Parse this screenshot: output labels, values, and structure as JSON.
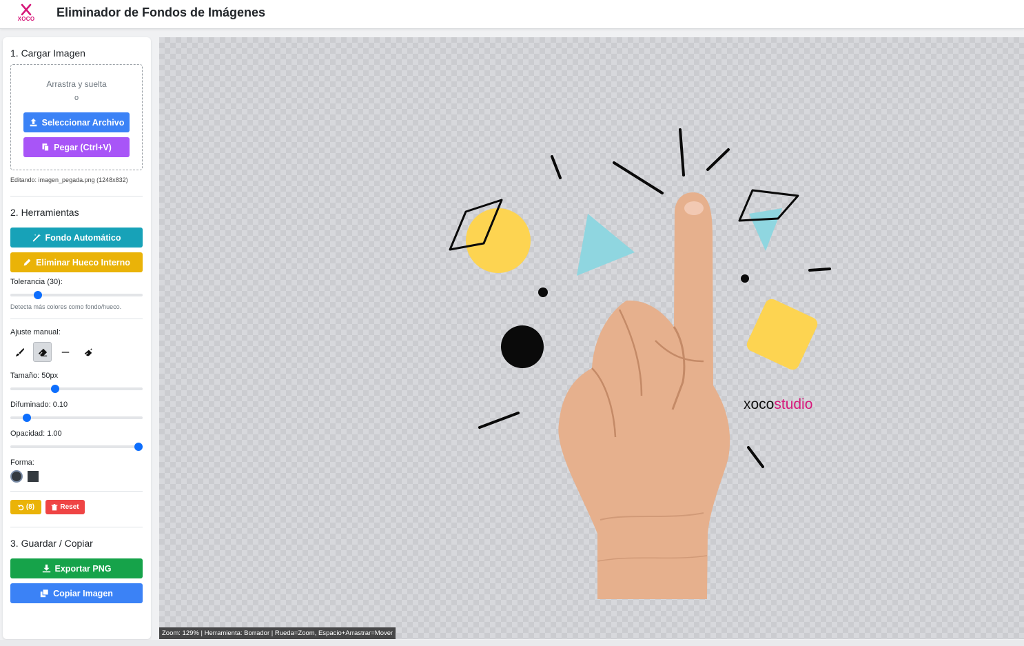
{
  "header": {
    "logo_text": "XOCO",
    "title": "Eliminador de Fondos de Imágenes"
  },
  "sidebar": {
    "section1": {
      "title": "1. Cargar Imagen",
      "drop_text": "Arrastra y suelta",
      "or_text": "o",
      "select_button": "Seleccionar Archivo",
      "paste_button": "Pegar (Ctrl+V)",
      "editing_note": "Editando: imagen_pegada.png (1248x832)"
    },
    "section2": {
      "title": "2. Herramientas",
      "auto_bg_button": "Fondo Automático",
      "remove_hole_button": "Eliminar Hueco Interno",
      "tolerance_label": "Tolerancia (30):",
      "tolerance_value": 30,
      "tolerance_note": "Detecta más colores como fondo/hueco.",
      "manual_label": "Ajuste manual:",
      "tools": [
        "brush-icon",
        "eraser-icon",
        "line-icon",
        "magic-eraser-icon"
      ],
      "active_tool": "eraser-icon",
      "size_label": "Tamaño: 50px",
      "size_value": 50,
      "feather_label": "Difuminado: 0.10",
      "feather_value": 0.1,
      "opacity_label": "Opacidad: 1.00",
      "opacity_value": 1.0,
      "shape_label": "Forma:",
      "shapes": [
        "circle",
        "square"
      ],
      "selected_shape": "circle",
      "undo_button": "(8)",
      "reset_button": "Reset"
    },
    "section3": {
      "title": "3. Guardar / Copiar",
      "export_button": "Exportar PNG",
      "copy_button": "Copiar Imagen"
    }
  },
  "canvas": {
    "watermark_left": "xoco",
    "watermark_right": "studio",
    "status": "Zoom: 129% | Herramienta: Borrador | Rueda=Zoom, Espacio+Arrastrar=Mover"
  },
  "colors": {
    "primary_blue": "#3b82f6",
    "purple": "#a855f7",
    "teal": "#17a2b8",
    "yellow": "#eab308",
    "red": "#ef4444",
    "green": "#16a34a",
    "brand_pink": "#d6187a"
  }
}
